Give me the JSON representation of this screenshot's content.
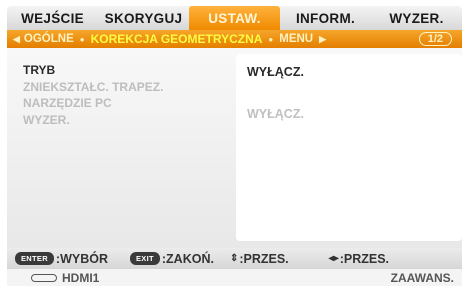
{
  "tabs": [
    {
      "label": "WEJŚCIE",
      "active": false
    },
    {
      "label": "SKORYGUJ",
      "active": false
    },
    {
      "label": "USTAW.",
      "active": true
    },
    {
      "label": "INFORM.",
      "active": false
    },
    {
      "label": "WYZER.",
      "active": false
    }
  ],
  "subtabs": {
    "prev": "OGÓLNE",
    "current": "KOREKCJA GEOMETRYCZNA",
    "next": "MENU",
    "page": "1/2"
  },
  "settings": [
    {
      "label": "TRYB",
      "value": "WYŁĄCZ.",
      "enabled": true
    },
    {
      "label": "ZNIEKSZTAŁC. TRAPEZ.",
      "value": "",
      "enabled": false
    },
    {
      "label": "NARZĘDZIE PC",
      "value": "WYŁĄCZ.",
      "enabled": false
    },
    {
      "label": "WYZER.",
      "value": "",
      "enabled": false
    }
  ],
  "help": {
    "enter_key": "ENTER",
    "enter_label": ":WYBÓR",
    "exit_key": "EXIT",
    "exit_label": ":ZAKOŃ.",
    "updown_label": ":PRZES.",
    "leftright_label": ":PRZES."
  },
  "status": {
    "source": "HDMI1",
    "mode": "ZAAWANS."
  },
  "colors": {
    "accent": "#f08a00",
    "current_subtab": "#fffb40"
  }
}
